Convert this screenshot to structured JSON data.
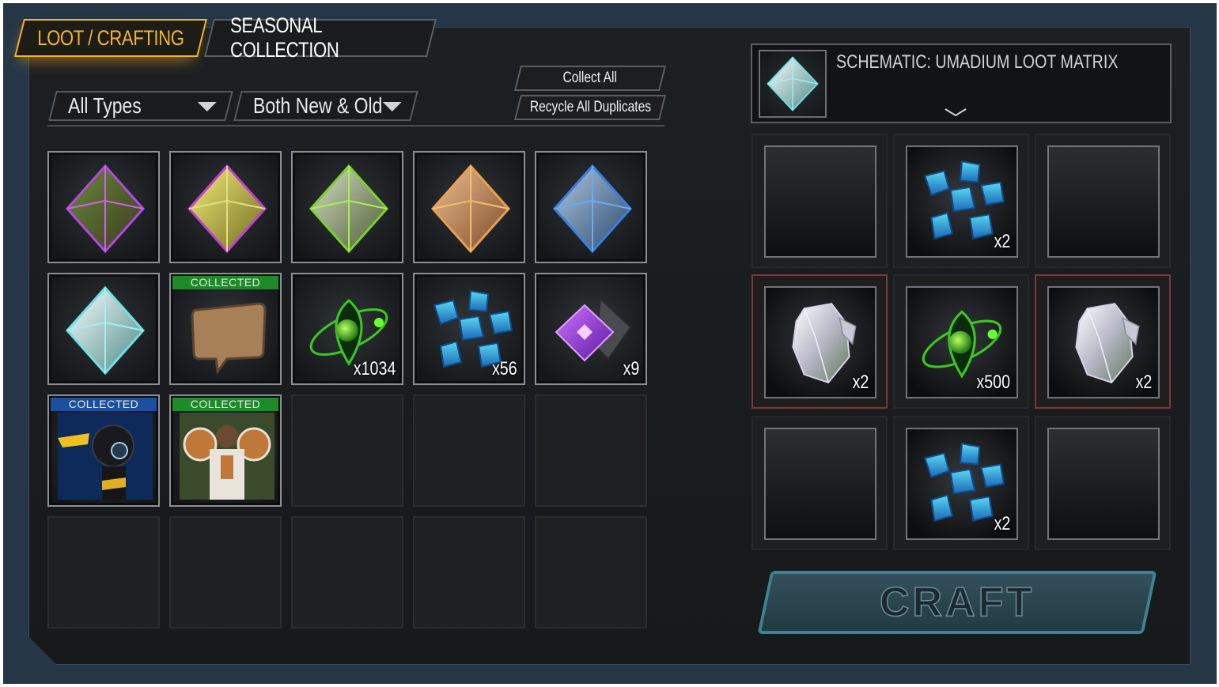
{
  "tabs": [
    {
      "label": "LOOT / CRAFTING",
      "active": true
    },
    {
      "label": "SEASONAL COLLECTION",
      "active": false
    }
  ],
  "filters": {
    "type_value": "All Types",
    "age_value": "Both New & Old"
  },
  "actions": {
    "collect_all": "Collect All",
    "recycle_duplicates": "Recycle All Duplicates"
  },
  "inventory": [
    {
      "icon": "loot-matrix-purple-icon",
      "color": "#9a3fd0"
    },
    {
      "icon": "loot-matrix-gold-icon",
      "color": "#d8c43a"
    },
    {
      "icon": "loot-matrix-green-icon",
      "color": "#7fbf3a"
    },
    {
      "icon": "loot-matrix-bronze-icon",
      "color": "#c88a4a"
    },
    {
      "icon": "loot-matrix-blue-icon",
      "color": "#3c7fd0"
    },
    {
      "icon": "loot-matrix-umadium-icon",
      "color": "#8fd8d0"
    },
    {
      "icon": "speech-bubble-icon",
      "badge": "COLLECTED",
      "badge_color": "green"
    },
    {
      "icon": "green-orbit-core-icon",
      "qty": "x1034"
    },
    {
      "icon": "blue-crystal-cluster-icon",
      "qty": "x56"
    },
    {
      "icon": "purple-gem-icon",
      "qty": "x9"
    },
    {
      "icon": "robot-character-icon",
      "badge": "COLLECTED",
      "badge_color": "blue"
    },
    {
      "icon": "armored-hero-icon",
      "badge": "COLLECTED",
      "badge_color": "green"
    }
  ],
  "schematic": {
    "title": "SCHEMATIC: UMADIUM LOOT MATRIX",
    "icon": "loot-matrix-umadium-icon"
  },
  "recipe": [
    {
      "icon": "",
      "qty": ""
    },
    {
      "icon": "blue-crystal-cluster-icon",
      "qty": "x2"
    },
    {
      "icon": "",
      "qty": ""
    },
    {
      "icon": "raw-crystal-icon",
      "qty": "x2",
      "missing": true
    },
    {
      "icon": "green-orbit-core-icon",
      "qty": "x500"
    },
    {
      "icon": "raw-crystal-icon",
      "qty": "x2",
      "missing": true
    },
    {
      "icon": "",
      "qty": ""
    },
    {
      "icon": "blue-crystal-cluster-icon",
      "qty": "x2"
    },
    {
      "icon": "",
      "qty": ""
    }
  ],
  "craft_label": "CRAFT",
  "colors": {
    "accent": "#f5b52a",
    "frame": "#253646",
    "craft_border": "#3c8393"
  }
}
